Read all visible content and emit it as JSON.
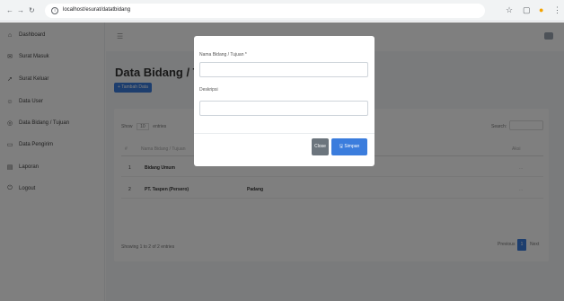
{
  "browser": {
    "back": "←",
    "forward": "→",
    "reload": "↻",
    "url": "localhost/esurat/datatbidang"
  },
  "sidebar": {
    "items": [
      {
        "label": "Dashboard",
        "icon": "home-icon",
        "glyph": "⌂"
      },
      {
        "label": "Surat Masuk",
        "icon": "inbox-icon",
        "glyph": "✉"
      },
      {
        "label": "Surat Keluar",
        "icon": "send-icon",
        "glyph": "➚"
      },
      {
        "label": "Data User",
        "icon": "users-icon",
        "glyph": "☺"
      },
      {
        "label": "Data Bidang / Tujuan",
        "icon": "target-icon",
        "glyph": "◎"
      },
      {
        "label": "Data Pengirim",
        "icon": "card-icon",
        "glyph": "▭"
      },
      {
        "label": "Laporan",
        "icon": "report-icon",
        "glyph": "▤"
      },
      {
        "label": "Logout",
        "icon": "logout-icon",
        "glyph": "⏻"
      }
    ]
  },
  "main": {
    "title": "Data Bidang / Tujuan",
    "add_button": "+ Tambah Data",
    "table": {
      "show_prefix": "Show",
      "entries_value": "10",
      "entries_suffix": "entries",
      "search_label": "Search:",
      "headers": [
        "#",
        "Nama Bidang / Tujuan",
        "Aksi"
      ],
      "rows": [
        {
          "no": "1",
          "nama": "Bidang Umum",
          "deskripsi": "",
          "aksi": "..."
        },
        {
          "no": "2",
          "nama": "PT. Taspen (Persero)",
          "deskripsi": "Padang",
          "aksi": "..."
        }
      ],
      "showing": "Showing 1 to 2 of 2 entries",
      "pagination": {
        "previous": "Previous",
        "page": "1",
        "next": "Next"
      }
    }
  },
  "modal": {
    "field1_label": "Nama Bidang / Tujuan *",
    "field1_value": "",
    "field2_label": "Deskripsi",
    "field2_value": "",
    "close_label": "Close",
    "save_label": "🖫 Simpan"
  },
  "colors": {
    "primary": "#3b7ddd",
    "secondary": "#6c757d"
  }
}
